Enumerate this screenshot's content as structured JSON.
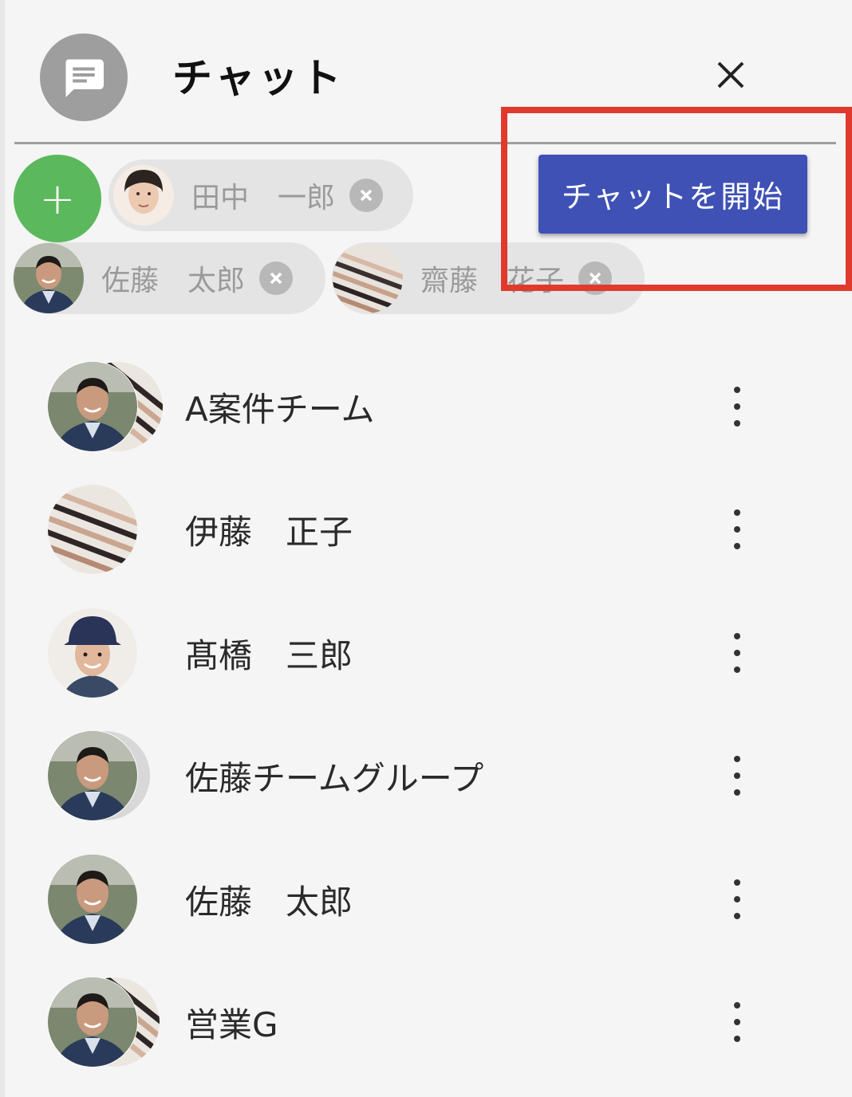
{
  "header": {
    "title": "チャット",
    "icon": "chat-message-icon",
    "close_icon": "close-icon"
  },
  "selected": {
    "add_label": "+",
    "chips": [
      {
        "name": "田中　一郎",
        "avatar": "person-avatar-tanaka"
      },
      {
        "name": "佐藤　太郎",
        "avatar": "person-avatar-sato"
      },
      {
        "name": "齋藤　花子",
        "avatar": "person-avatar-saito"
      }
    ],
    "start_button": "チャットを開始"
  },
  "chats": [
    {
      "name": "A案件チーム",
      "avatar": "group-avatar"
    },
    {
      "name": "伊藤　正子",
      "avatar": "person-avatar"
    },
    {
      "name": "髙橋　三郎",
      "avatar": "person-avatar"
    },
    {
      "name": "佐藤チームグループ",
      "avatar": "group-avatar"
    },
    {
      "name": "佐藤　太郎",
      "avatar": "person-avatar"
    },
    {
      "name": "営業G",
      "avatar": "group-avatar"
    }
  ],
  "colors": {
    "accent": "#3f51b5",
    "add": "#5cb85c",
    "highlight": "#e03a2f",
    "icon_bg": "#9e9e9e"
  }
}
